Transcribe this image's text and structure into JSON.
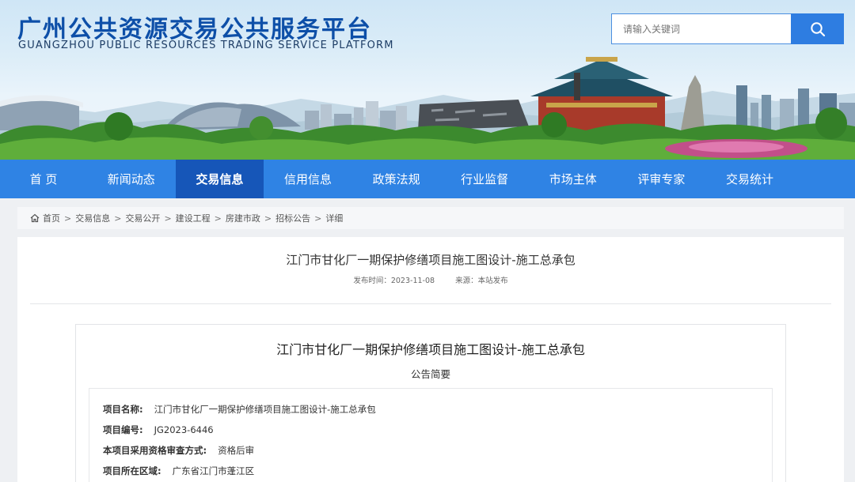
{
  "header": {
    "title": "广州公共资源交易公共服务平台",
    "subtitle": "GUANGZHOU PUBLIC RESOURCES TRADING SERVICE PLATFORM",
    "search": {
      "placeholder": "请输入关键词"
    },
    "colors": {
      "brand": "#0d4fa8",
      "nav": "#2f83e4",
      "nav_active": "#1656b8",
      "search_button": "#2e7de1"
    }
  },
  "nav": {
    "items": [
      {
        "label": "首 页"
      },
      {
        "label": "新闻动态"
      },
      {
        "label": "交易信息",
        "active": true
      },
      {
        "label": "信用信息"
      },
      {
        "label": "政策法规"
      },
      {
        "label": "行业监督"
      },
      {
        "label": "市场主体"
      },
      {
        "label": "评审专家"
      },
      {
        "label": "交易统计"
      }
    ]
  },
  "breadcrumb": {
    "icon": "home-icon",
    "items": [
      "首页",
      "交易信息",
      "交易公开",
      "建设工程",
      "房建市政",
      "招标公告",
      "详细"
    ],
    "separator": ">"
  },
  "article": {
    "title": "江门市甘化厂一期保护修缮项目施工图设计-施工总承包",
    "published_label": "发布时间：",
    "published": "2023-11-08",
    "source_label": "来源：",
    "source": "本站发布"
  },
  "notice": {
    "title": "江门市甘化厂一期保护修缮项目施工图设计-施工总承包",
    "subtitle": "公告简要",
    "fields": [
      {
        "label": "项目名称:",
        "value": "江门市甘化厂一期保护修缮项目施工图设计-施工总承包"
      },
      {
        "label": "项目编号:",
        "value": "JG2023-6446"
      },
      {
        "label": "本项目采用资格审查方式:",
        "value": "资格后审"
      },
      {
        "label": "项目所在区域:",
        "value": "广东省江门市蓬江区"
      }
    ]
  }
}
